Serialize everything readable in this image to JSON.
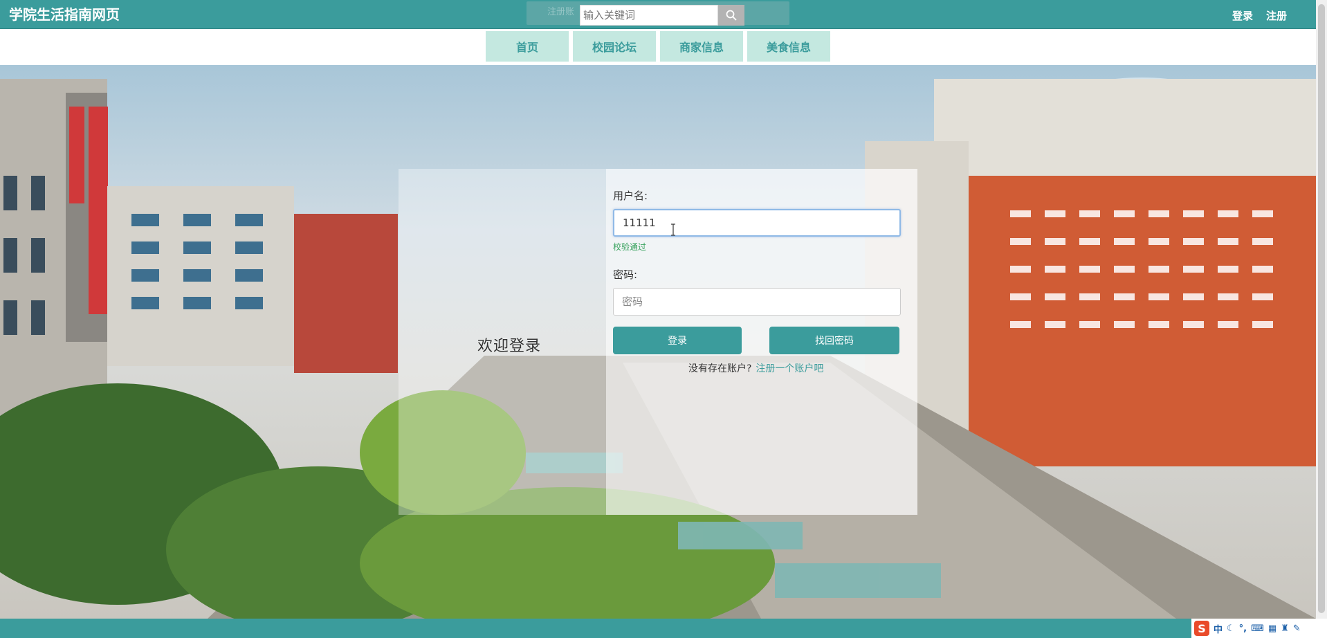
{
  "header": {
    "brand": "学院生活指南网页",
    "search_placeholder": "输入关键词",
    "search_ghost_text": "注册账",
    "login_link": "登录",
    "register_link": "注册"
  },
  "nav": {
    "items": [
      {
        "label": "首页"
      },
      {
        "label": "校园论坛"
      },
      {
        "label": "商家信息"
      },
      {
        "label": "美食信息"
      }
    ]
  },
  "login": {
    "welcome_title": "欢迎登录",
    "username_label": "用户名:",
    "username_value": "11111",
    "username_valid_hint": "校验通过",
    "password_label": "密码:",
    "password_placeholder": "密码",
    "login_button": "登录",
    "recover_button": "找回密码",
    "no_account_text": "没有存在账户?",
    "register_link_text": "注册一个账户吧"
  },
  "taskbar": {
    "ime_mode": "中"
  },
  "colors": {
    "primary": "#3b9c9c",
    "nav_bg": "#c4e8e0",
    "valid": "#3aa35f"
  }
}
